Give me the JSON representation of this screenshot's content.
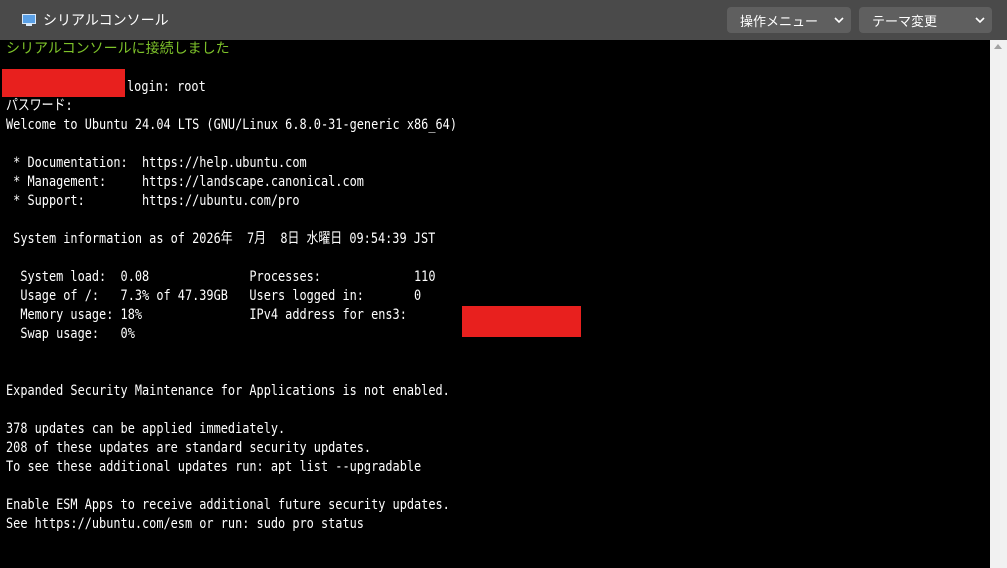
{
  "titlebar": {
    "icon": "monitor-icon",
    "title": "シリアルコンソール",
    "operations_menu": "操作メニュー",
    "theme_menu": "テーマ変更"
  },
  "terminal": {
    "connected_message": "シリアルコンソールに接続しました",
    "login_line": "login: root",
    "password_prompt": "パスワード:",
    "welcome": "Welcome to Ubuntu 24.04 LTS (GNU/Linux 6.8.0-31-generic x86_64)",
    "doc_line": " * Documentation:  https://help.ubuntu.com",
    "mgmt_line": " * Management:     https://landscape.canonical.com",
    "support_line": " * Support:        https://ubuntu.com/pro",
    "sysinfo_line": " System information as of 2026年  7月  8日 水曜日 09:54:39 JST",
    "load_line": "  System load:  0.08              Processes:             110",
    "usage_line": "  Usage of /:   7.3% of 47.39GB   Users logged in:       0",
    "memory_line": "  Memory usage: 18%               IPv4 address for ens3:",
    "swap_line": "  Swap usage:   0%",
    "esm_line": "Expanded Security Maintenance for Applications is not enabled.",
    "updates_line": "378 updates can be applied immediately.",
    "security_line": "208 of these updates are standard security updates.",
    "apt_line": "To see these additional updates run: apt list --upgradable",
    "esm_apps_line": "Enable ESM Apps to receive additional future security updates.",
    "esm_status_line": "See https://ubuntu.com/esm or run: sudo pro status"
  },
  "colors": {
    "titlebar_bg": "#4a4a4a",
    "terminal_bg": "#000000",
    "terminal_fg": "#ffffff",
    "connected_green": "#7ec32a",
    "redaction_red": "#e8201e"
  }
}
